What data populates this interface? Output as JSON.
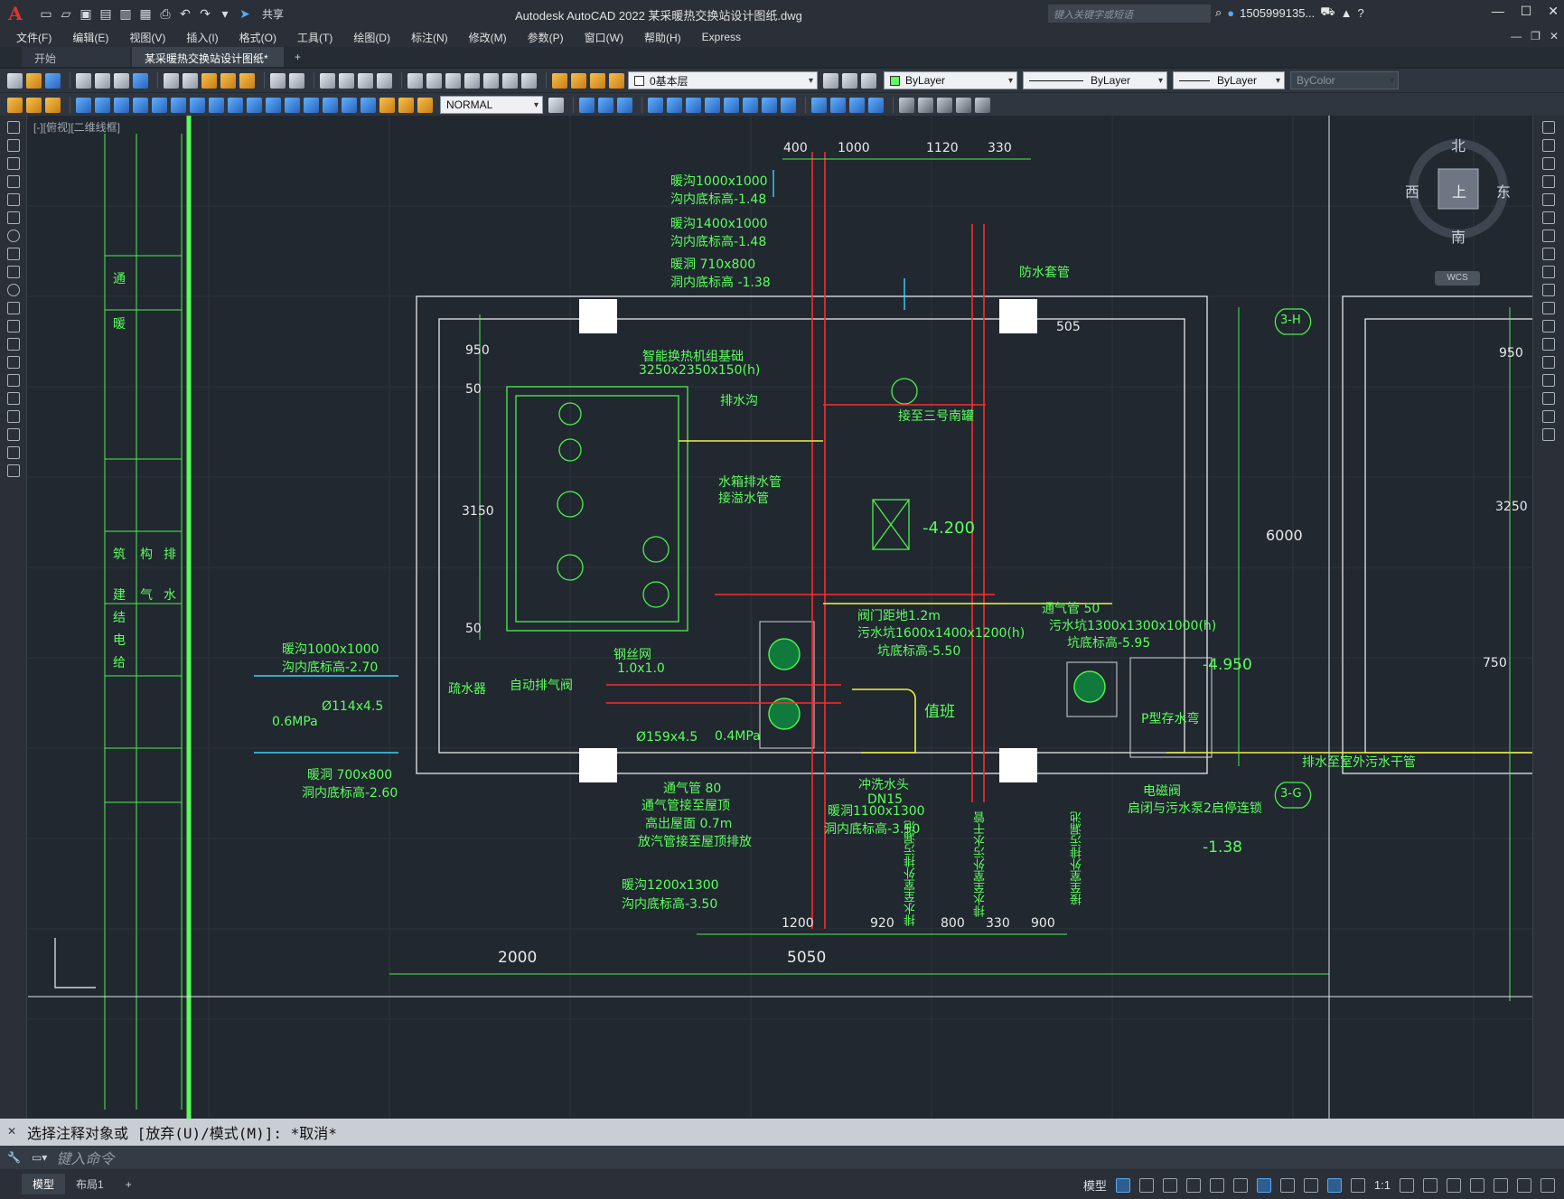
{
  "app": {
    "logo": "A",
    "title": "Autodesk AutoCAD 2022    某采暖热交换站设计图纸.dwg",
    "share_label": "共享",
    "search_placeholder": "键入关键字或短语",
    "user": "1505999135...",
    "window_controls": [
      "—",
      "☐",
      "✕"
    ]
  },
  "menu": [
    "文件(F)",
    "编辑(E)",
    "视图(V)",
    "插入(I)",
    "格式(O)",
    "工具(T)",
    "绘图(D)",
    "标注(N)",
    "修改(M)",
    "参数(P)",
    "窗口(W)",
    "帮助(H)",
    "Express"
  ],
  "tabs": [
    {
      "label": "开始"
    },
    {
      "label": "某采暖热交换站设计图纸*"
    }
  ],
  "tab_add": "+",
  "toolbar": {
    "layer": "0基本层",
    "color": "ByLayer",
    "linetype": "ByLayer",
    "lineweight": "ByLayer",
    "plotstyle": "ByColor",
    "textstyle": "NORMAL"
  },
  "viewport": {
    "label": "[-][俯视][二维线框]",
    "compass": {
      "n": "北",
      "s": "南",
      "e": "东",
      "w": "西",
      "top": "上"
    },
    "wcs": "WCS"
  },
  "drawing": {
    "top_dims": [
      "400",
      "1000",
      "1120",
      "330"
    ],
    "bottom_dims": [
      "1200",
      "920",
      "800",
      "330",
      "900"
    ],
    "overall_dims": [
      "2000",
      "5050"
    ],
    "left_dims": [
      "950",
      "50",
      "3150",
      "50"
    ],
    "right_dims": [
      "505",
      "6000",
      "950",
      "3250",
      "750"
    ],
    "elevation_main": "-4.200",
    "elevation_right": "-4.950",
    "elevation_low": "-1.38",
    "grid_h": "3-H",
    "grid_g": "3-G",
    "title_strip_top": [
      "通",
      "暖"
    ],
    "title_strip_bottom": [
      "建",
      "结",
      "电",
      "给",
      "筑",
      "构",
      "气",
      "排",
      "水"
    ],
    "labels": [
      "暖沟1000x1000",
      "沟内底标高-1.48",
      "暖沟1400x1000",
      "沟内底标高-1.48",
      "暖洞 710x800",
      "洞内底标高 -1.38",
      "防水套管",
      "智能换热机组基础",
      "3250x2350x150(h)",
      "排水沟",
      "接至三号南罐",
      "水箱排水管",
      "接溢水管",
      "暖沟1000x1000",
      "沟内底标高-2.70",
      "疏水器",
      "自动排气阀",
      "钢丝网",
      "1.0x1.0",
      "阀门距地1.2m",
      "污水坑1600x1400x1200(h)",
      "坑底标高-5.50",
      "通气管 50",
      "污水坑1300x1300x1000(h)",
      "坑底标高-5.95",
      "P型存水弯",
      "排水至室外污水干管",
      "值班",
      "暖洞 700x800",
      "洞内底标高-2.60",
      "通气管 80",
      "通气管接至屋顶",
      "高出屋面 0.7m",
      "放汽管接至屋顶排放",
      "冲洗水头",
      "DN15",
      "暖洞1100x1300",
      "洞内底标高-3.50",
      "暖沟1200x1300",
      "沟内底标高-3.50",
      "电磁阀",
      "启闭与污水泵2启停连锁",
      "排水至室外排污漏池",
      "排水至室外污水干管",
      "接至室外排污漏池",
      "Ø114x4.5",
      "Ø159x4.5",
      "0.6MPa",
      "0.4MPa"
    ]
  },
  "command": {
    "history": "选择注释对象或 [放弃(U)/模式(M)]: *取消*",
    "placeholder": "键入命令"
  },
  "status": {
    "layout_tabs": [
      "模型",
      "布局1"
    ],
    "model_label": "模型",
    "scale": "1:1"
  }
}
